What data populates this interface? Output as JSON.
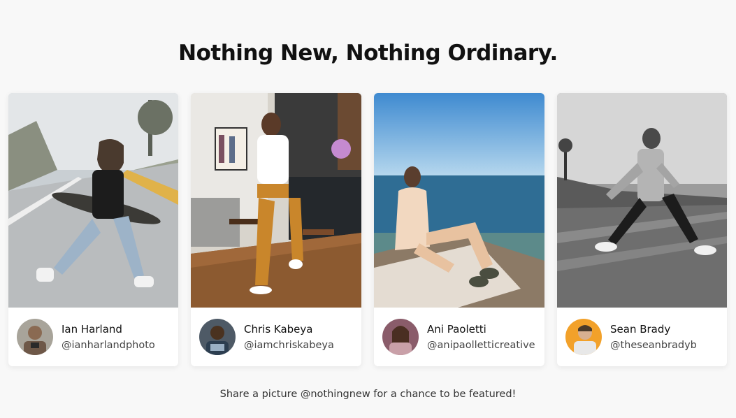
{
  "heading": "Nothing New, Nothing Ordinary.",
  "cards": [
    {
      "name": "Ian Harland",
      "handle": "@ianharlandphoto",
      "photo_icon": "photo-skateboard-road",
      "avatar_icon": "avatar-ian"
    },
    {
      "name": "Chris Kabeya",
      "handle": "@iamchriskabeya",
      "photo_icon": "photo-kitchen",
      "avatar_icon": "avatar-chris"
    },
    {
      "name": "Ani Paoletti",
      "handle": "@anipaolletticreative",
      "photo_icon": "photo-seaside-rock",
      "avatar_icon": "avatar-ani"
    },
    {
      "name": "Sean Brady",
      "handle": "@theseanbradyb",
      "photo_icon": "photo-beach-jump",
      "avatar_icon": "avatar-sean"
    }
  ],
  "footer": "Share a picture @nothingnew for a chance to be featured!"
}
